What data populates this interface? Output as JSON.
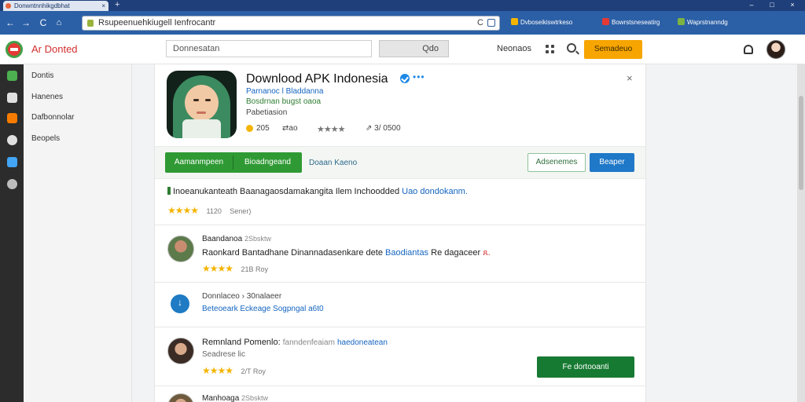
{
  "browser": {
    "tab_title": "Donwntnnhikgdbhat",
    "tab_close": "×",
    "new_tab": "+",
    "window_controls": [
      "–",
      "□",
      "×"
    ],
    "nav_buttons": [
      "←",
      "→",
      "C",
      "⌂"
    ],
    "url": "Rsupeenuehkiugell Ienfrocantr",
    "reload_glyph": "C",
    "extensions": [
      "Dvboseikiswtrkeso",
      "Bowrstsneseatirg",
      "Waprstnanndg"
    ],
    "extension_colors": [
      "#f5b400",
      "#e53935",
      "#7cb342"
    ]
  },
  "header": {
    "brand": "Ar Donted",
    "search_placeholder": "Donnesatan",
    "search_button": "Qdo",
    "nav_link": "Neonaos",
    "cta": "Semadeuo"
  },
  "rail": {
    "icons": [
      "download-icon",
      "chart-icon",
      "box-icon",
      "gear-icon",
      "window-icon",
      "camera-icon"
    ],
    "colors": [
      "#4caf50",
      "#e0e0e0",
      "#f57c00",
      "#e0e0e0",
      "#42a5f5",
      "#bdbdbd"
    ]
  },
  "sidebar": {
    "items": [
      "Dontis",
      "Hanenes",
      "Dafbonnolar",
      "Beopels"
    ]
  },
  "app": {
    "title": "Downlood APK Indonesia",
    "more": "•••",
    "close": "×",
    "developer": "Parnanoc l Bladdanna",
    "category": "Bosdrnan bugst oaoa",
    "subtitle": "Pabetiasion",
    "downloads": "205",
    "share": "⇄ao",
    "rating_stars": "★★★★",
    "installs": "⇗ 3/ 0500"
  },
  "actions": {
    "primary_left": "Aamanmpeen",
    "primary_right": "Bioadngeand",
    "ghost_link": "Doaan Kaeno",
    "outline_button": "Adsenemes",
    "blue_button": "Beaper"
  },
  "summary": {
    "text": "Inoeanukanteath Baanagaosdamakangita Ilem Inchoodded",
    "link": "Uao dondokanm.",
    "stars": "★★★★",
    "count": "1120",
    "note": "Sener)"
  },
  "reviews": [
    {
      "name": "Baandanoa",
      "sub": "2Sbsktw",
      "body": "Raonkard Bantadhane Dinannadasenkare dete",
      "link": "Baodiantas",
      "tail": "Re dagaceer",
      "mark": "ጸ.",
      "stars": "★★★★",
      "meta": "21B Roy",
      "avatar_bg": "#5c7a4a",
      "avatar_face": "#c88d70"
    },
    {
      "name": "Remnland Pomenlo:",
      "sub": "fanndenfeaiam",
      "link": "haedoneatean",
      "secondary": "Seadrese lic",
      "stars": "★★★★",
      "meta": "2/T Roy",
      "avatar_bg": "#3a2b24",
      "avatar_face": "#d9a98b"
    },
    {
      "name": "Manhoaga",
      "sub": "2Sbsktw",
      "avatar_bg": "#6e5a3c",
      "avatar_face": "#d6a889"
    }
  ],
  "info": {
    "title": "Donnlaceo › 30nalaeer",
    "link": "Beteoeark Eckeage Sogpngal a6t0"
  },
  "download_button": "Fe dortooanti"
}
